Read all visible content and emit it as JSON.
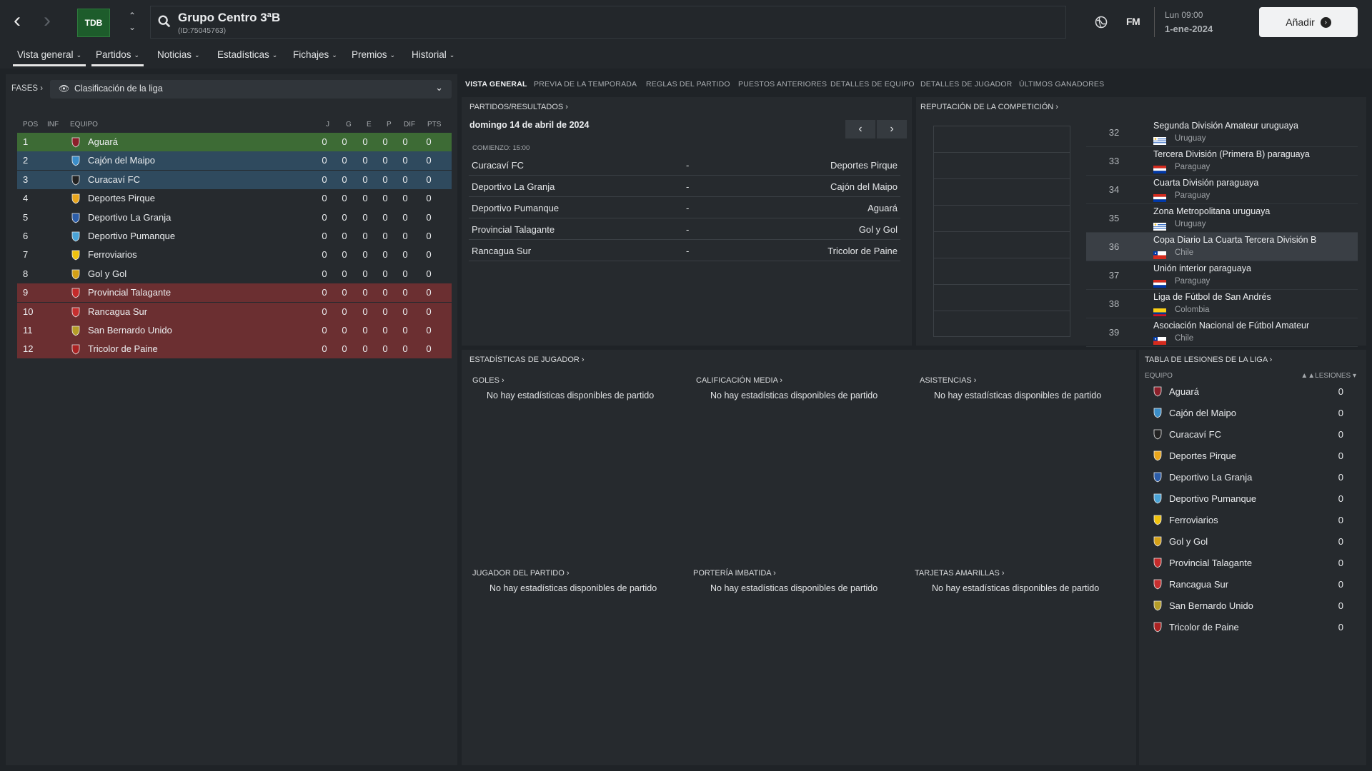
{
  "window": {
    "competition_title": "Grupo Centro 3ªB",
    "competition_id": "(ID:75045763)",
    "logo_text": "TDB",
    "time": "Lun 09:00",
    "date": "1-ene-2024",
    "add_button": "Añadir",
    "fm_logo": "FM"
  },
  "menu": [
    {
      "label": "Vista general",
      "active": true
    },
    {
      "label": "Partidos",
      "active": true
    },
    {
      "label": "Noticias"
    },
    {
      "label": "Estadísticas"
    },
    {
      "label": "Fichajes"
    },
    {
      "label": "Premios"
    },
    {
      "label": "Historial"
    }
  ],
  "left": {
    "fases_label": "FASES",
    "dropdown_label": "Clasificación de la liga",
    "headers": {
      "pos": "POS",
      "inf": "INF",
      "team": "EQUIPO",
      "j": "J",
      "g": "G",
      "e": "E",
      "p": "P",
      "dif": "DIF",
      "pts": "PTS"
    },
    "rows": [
      {
        "pos": "1",
        "team": "Aguará",
        "j": "0",
        "g": "0",
        "e": "0",
        "p": "0",
        "dif": "0",
        "pts": "0",
        "zone": "green"
      },
      {
        "pos": "2",
        "team": "Cajón del Maipo",
        "j": "0",
        "g": "0",
        "e": "0",
        "p": "0",
        "dif": "0",
        "pts": "0",
        "zone": "blue"
      },
      {
        "pos": "3",
        "team": "Curacaví FC",
        "j": "0",
        "g": "0",
        "e": "0",
        "p": "0",
        "dif": "0",
        "pts": "0",
        "zone": "blue"
      },
      {
        "pos": "4",
        "team": "Deportes Pirque",
        "j": "0",
        "g": "0",
        "e": "0",
        "p": "0",
        "dif": "0",
        "pts": "0",
        "zone": "none"
      },
      {
        "pos": "5",
        "team": "Deportivo La Granja",
        "j": "0",
        "g": "0",
        "e": "0",
        "p": "0",
        "dif": "0",
        "pts": "0",
        "zone": "none"
      },
      {
        "pos": "6",
        "team": "Deportivo Pumanque",
        "j": "0",
        "g": "0",
        "e": "0",
        "p": "0",
        "dif": "0",
        "pts": "0",
        "zone": "none"
      },
      {
        "pos": "7",
        "team": "Ferroviarios",
        "j": "0",
        "g": "0",
        "e": "0",
        "p": "0",
        "dif": "0",
        "pts": "0",
        "zone": "none"
      },
      {
        "pos": "8",
        "team": "Gol y Gol",
        "j": "0",
        "g": "0",
        "e": "0",
        "p": "0",
        "dif": "0",
        "pts": "0",
        "zone": "none"
      },
      {
        "pos": "9",
        "team": "Provincial Talagante",
        "j": "0",
        "g": "0",
        "e": "0",
        "p": "0",
        "dif": "0",
        "pts": "0",
        "zone": "red"
      },
      {
        "pos": "10",
        "team": "Rancagua Sur",
        "j": "0",
        "g": "0",
        "e": "0",
        "p": "0",
        "dif": "0",
        "pts": "0",
        "zone": "red"
      },
      {
        "pos": "11",
        "team": "San Bernardo Unido",
        "j": "0",
        "g": "0",
        "e": "0",
        "p": "0",
        "dif": "0",
        "pts": "0",
        "zone": "red"
      },
      {
        "pos": "12",
        "team": "Tricolor de Paine",
        "j": "0",
        "g": "0",
        "e": "0",
        "p": "0",
        "dif": "0",
        "pts": "0",
        "zone": "red"
      }
    ]
  },
  "subtabs": [
    "VISTA GENERAL",
    "PREVIA DE LA TEMPORADA",
    "REGLAS DEL PARTIDO",
    "PUESTOS ANTERIORES",
    "DETALLES DE EQUIPO",
    "DETALLES DE JUGADOR",
    "ÚLTIMOS GANADORES"
  ],
  "matches": {
    "title": "PARTIDOS/RESULTADOS",
    "date": "domingo 14 de abril de 2024",
    "kickoff": "COMIENZO: 15:00",
    "rows": [
      {
        "home": "Curacaví FC",
        "sep": "-",
        "away": "Deportes Pirque"
      },
      {
        "home": "Deportivo La Granja",
        "sep": "-",
        "away": "Cajón del Maipo"
      },
      {
        "home": "Deportivo Pumanque",
        "sep": "-",
        "away": "Aguará"
      },
      {
        "home": "Provincial Talagante",
        "sep": "-",
        "away": "Gol y Gol"
      },
      {
        "home": "Rancagua Sur",
        "sep": "-",
        "away": "Tricolor de Paine"
      }
    ]
  },
  "reputation": {
    "title": "REPUTACIÓN DE LA COMPETICIÓN",
    "rows": [
      {
        "rank": "32",
        "name": "Segunda División Amateur uruguaya",
        "country": "Uruguay",
        "flag": "uruguay"
      },
      {
        "rank": "33",
        "name": "Tercera División (Primera B) paraguaya",
        "country": "Paraguay",
        "flag": "paraguay"
      },
      {
        "rank": "34",
        "name": "Cuarta División paraguaya",
        "country": "Paraguay",
        "flag": "paraguay"
      },
      {
        "rank": "35",
        "name": "Zona Metropolitana uruguaya",
        "country": "Uruguay",
        "flag": "uruguay"
      },
      {
        "rank": "36",
        "name": "Copa Diario La Cuarta Tercera División B",
        "country": "Chile",
        "flag": "chile",
        "highlight": true
      },
      {
        "rank": "37",
        "name": "Unión interior paraguaya",
        "country": "Paraguay",
        "flag": "paraguay"
      },
      {
        "rank": "38",
        "name": "Liga de Fútbol de San Andrés",
        "country": "Colombia",
        "flag": "colombia"
      },
      {
        "rank": "39",
        "name": "Asociación Nacional de Fútbol Amateur",
        "country": "Chile",
        "flag": "chile"
      }
    ]
  },
  "player_stats": {
    "title": "ESTADÍSTICAS DE JUGADOR",
    "empty": "No hay estadísticas disponibles de partido",
    "goles": "GOLES",
    "calificacion": "CALIFICACIÓN MEDIA",
    "asistencias": "ASISTENCIAS",
    "jugador_partido": "JUGADOR DEL PARTIDO",
    "porteria": "PORTERÍA IMBATIDA",
    "tarjetas": "TARJETAS AMARILLAS"
  },
  "injuries": {
    "title": "TABLA DE LESIONES DE LA LIGA",
    "col_team": "EQUIPO",
    "col_injuries": "LESIONES",
    "rows": [
      {
        "team": "Aguará",
        "value": "0"
      },
      {
        "team": "Cajón del Maipo",
        "value": "0"
      },
      {
        "team": "Curacaví FC",
        "value": "0"
      },
      {
        "team": "Deportes Pirque",
        "value": "0"
      },
      {
        "team": "Deportivo La Granja",
        "value": "0"
      },
      {
        "team": "Deportivo Pumanque",
        "value": "0"
      },
      {
        "team": "Ferroviarios",
        "value": "0"
      },
      {
        "team": "Gol y Gol",
        "value": "0"
      },
      {
        "team": "Provincial Talagante",
        "value": "0"
      },
      {
        "team": "Rancagua Sur",
        "value": "0"
      },
      {
        "team": "San Bernardo Unido",
        "value": "0"
      },
      {
        "team": "Tricolor de Paine",
        "value": "0"
      }
    ]
  },
  "colors": {
    "zone_green": "#3d6b35",
    "zone_blue": "#2f4a5e",
    "zone_red": "#6b2f31"
  }
}
